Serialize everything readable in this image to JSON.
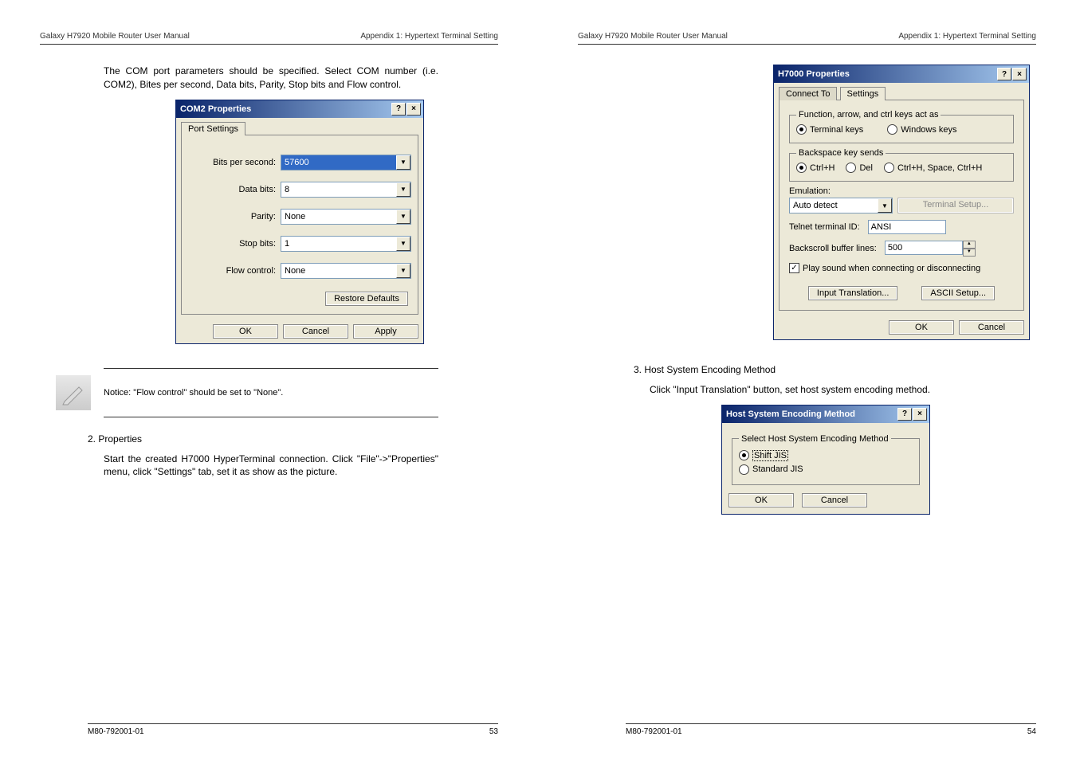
{
  "header": {
    "left": "Galaxy H7920 Mobile Router User Manual",
    "right": "Appendix 1: Hypertext Terminal Setting"
  },
  "footer": {
    "docnum": "M80-792001-01",
    "page_left": "53",
    "page_right": "54"
  },
  "left_page": {
    "intro": "The COM port parameters should be specified. Select COM number (i.e. COM2), Bites per second, Data bits, Parity, Stop bits and Flow control.",
    "dlg1": {
      "title": "COM2 Properties",
      "tab": "Port Settings",
      "bits_label": "Bits per second:",
      "bits_val": "57600",
      "databits_label": "Data bits:",
      "databits_val": "8",
      "parity_label": "Parity:",
      "parity_val": "None",
      "stopbits_label": "Stop bits:",
      "stopbits_val": "1",
      "flow_label": "Flow control:",
      "flow_val": "None",
      "restore": "Restore Defaults",
      "ok": "OK",
      "cancel": "Cancel",
      "apply": "Apply"
    },
    "notice": "Notice: \"Flow control\" should be set to \"None\".",
    "section2_title": "2.  Properties",
    "section2_text": "Start the created H7000 HyperTerminal connection. Click \"File\"->\"Properties\" menu, click \"Settings\" tab, set it as show as the picture."
  },
  "right_page": {
    "dlg2": {
      "title": "H7000 Properties",
      "tab_connect": "Connect To",
      "tab_settings": "Settings",
      "grp1_legend": "Function, arrow, and ctrl keys act as",
      "terminal_keys": "Terminal keys",
      "windows_keys": "Windows keys",
      "grp2_legend": "Backspace key sends",
      "ctrlh": "Ctrl+H",
      "del": "Del",
      "ctrlh_space": "Ctrl+H, Space, Ctrl+H",
      "emulation_lbl": "Emulation:",
      "emulation_val": "Auto detect",
      "term_setup": "Terminal Setup...",
      "telnet_lbl": "Telnet terminal ID:",
      "telnet_val": "ANSI",
      "backscroll_lbl": "Backscroll buffer lines:",
      "backscroll_val": "500",
      "play_sound": "Play sound when connecting or disconnecting",
      "input_trans": "Input Translation...",
      "ascii_setup": "ASCII Setup...",
      "ok": "OK",
      "cancel": "Cancel"
    },
    "section3_title": "3.  Host System Encoding Method",
    "section3_text": "Click \"Input Translation\" button, set host system encoding method.",
    "dlg3": {
      "title": "Host System Encoding Method",
      "legend": "Select Host System Encoding Method",
      "shiftjis": "Shift JIS",
      "standardjis": "Standard JIS",
      "ok": "OK",
      "cancel": "Cancel"
    }
  }
}
